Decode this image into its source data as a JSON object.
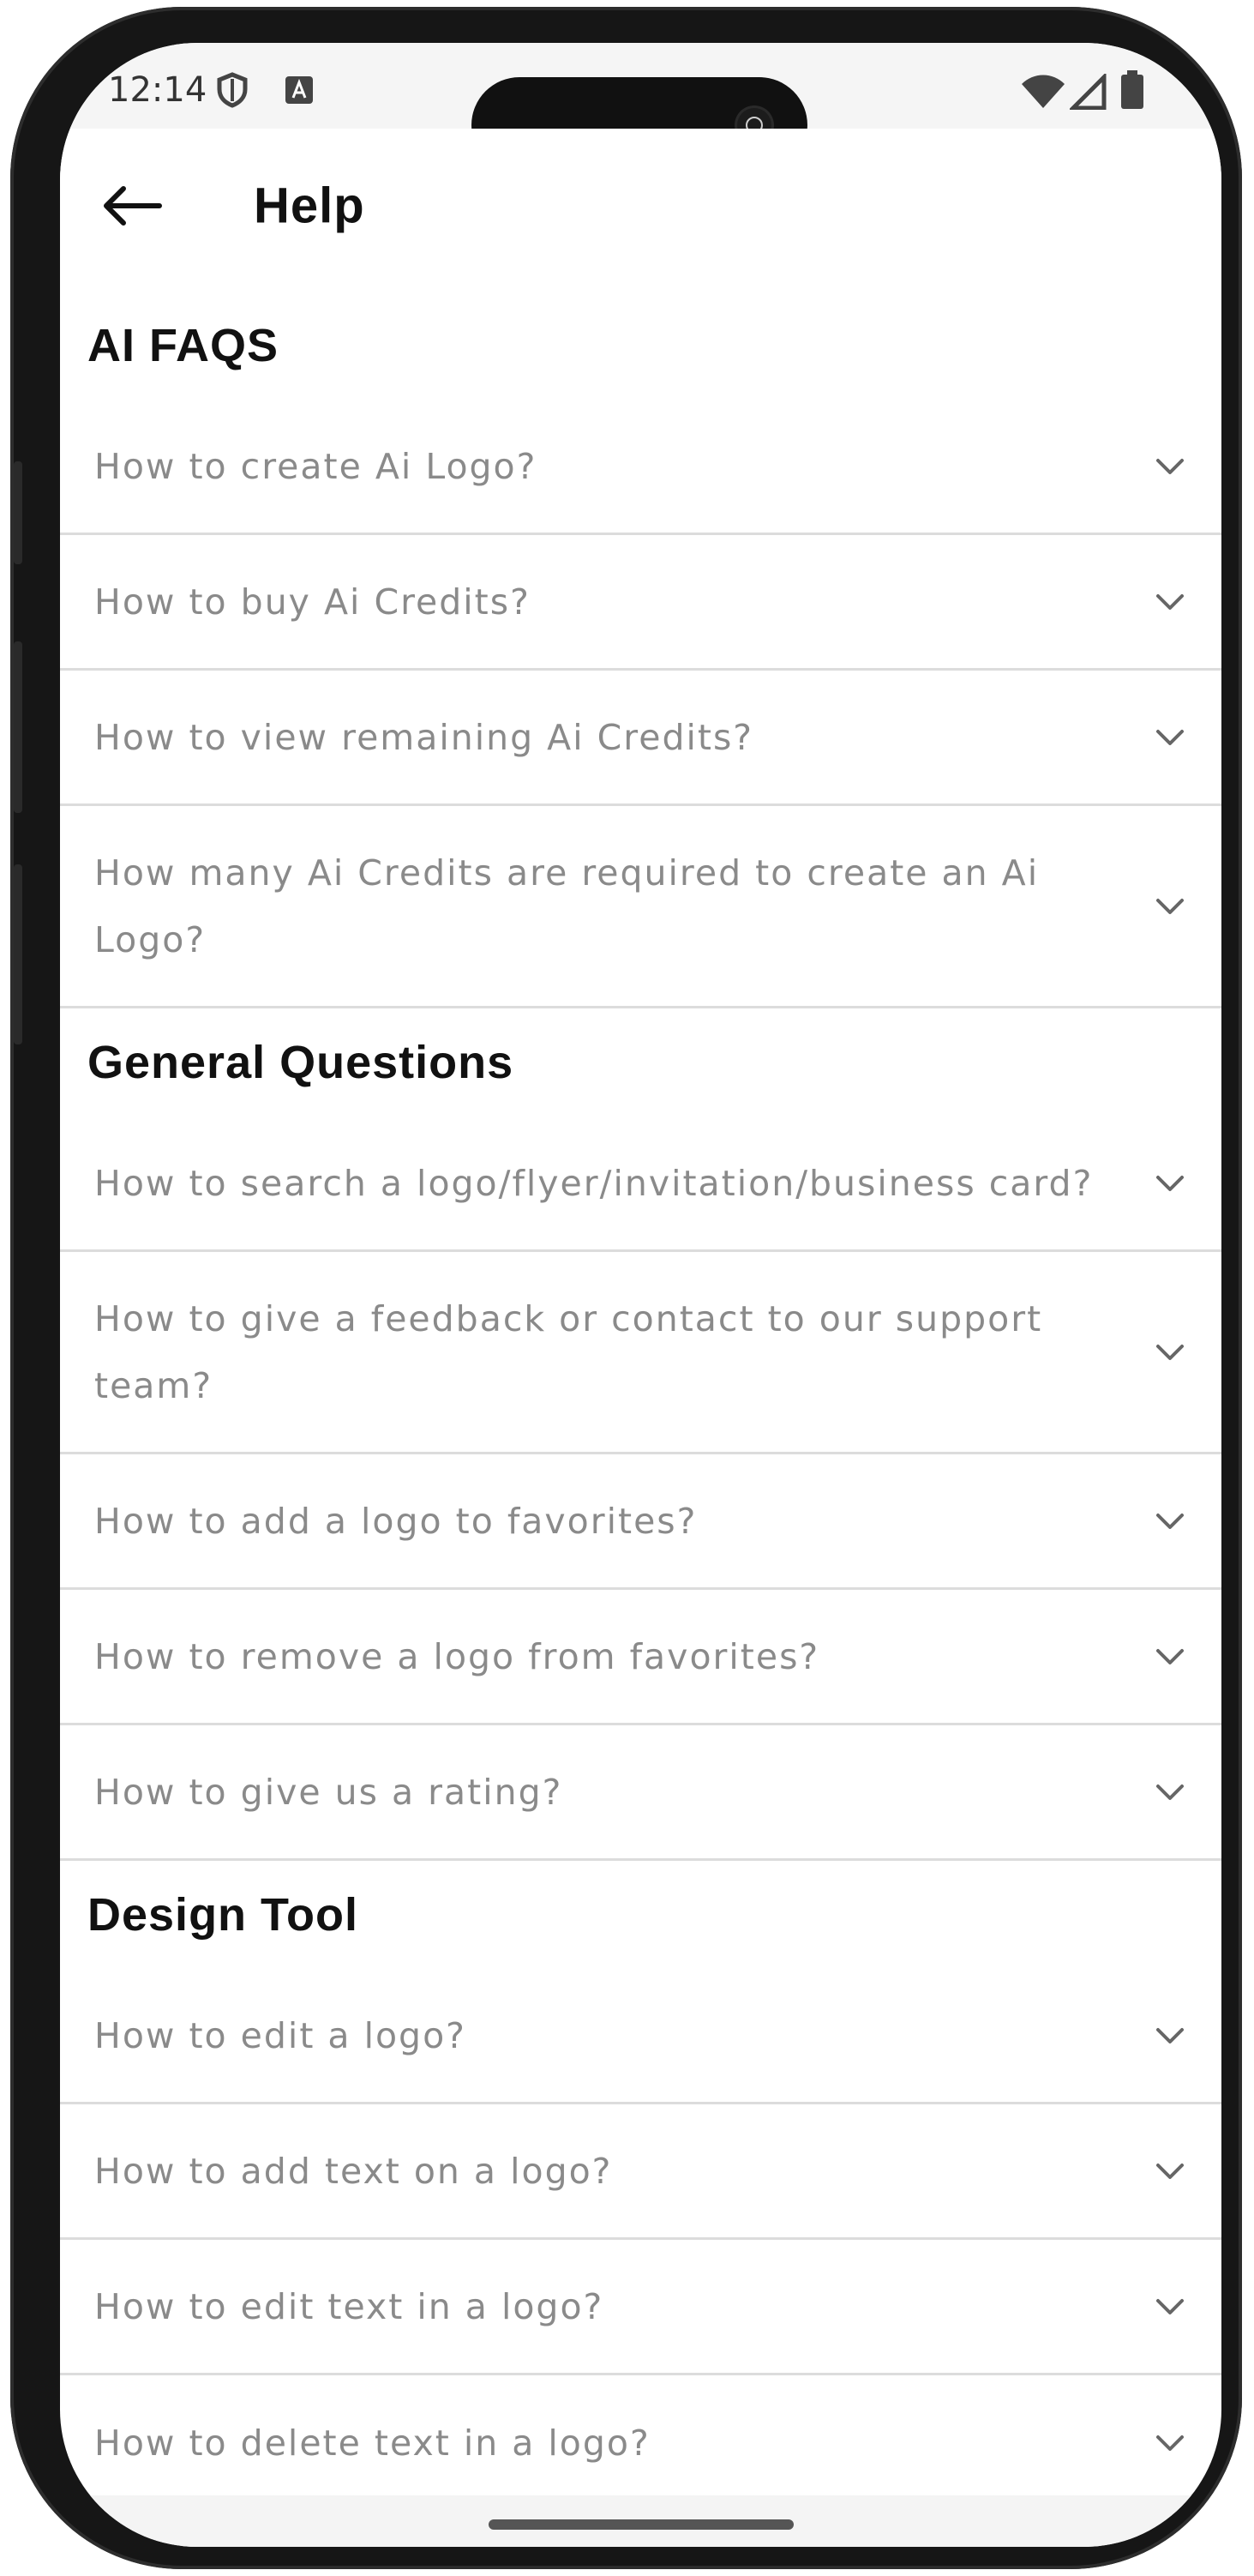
{
  "status_bar": {
    "time": "12:14",
    "icons_left": [
      "shield-icon",
      "app-a-icon"
    ],
    "icons_right": [
      "wifi-icon",
      "cell-signal-icon",
      "battery-icon"
    ]
  },
  "app_bar": {
    "back_icon": "arrow-left-icon",
    "title": "Help"
  },
  "sections": [
    {
      "title": "AI FAQS",
      "items": [
        "How to create Ai Logo?",
        "How to buy Ai Credits?",
        "How to view remaining Ai Credits?",
        "How many Ai Credits are required to create an Ai Logo?"
      ]
    },
    {
      "title": "General Questions",
      "items": [
        "How to search a logo/flyer/invitation/business card?",
        "How to give a feedback or contact to our support team?",
        "How to add a logo to favorites?",
        "How to remove a logo from favorites?",
        "How to give us a rating?"
      ]
    },
    {
      "title": "Design Tool",
      "items": [
        "How to edit a logo?",
        "How to add text on a logo?",
        "How to edit text in a logo?",
        "How to delete text in a logo?"
      ]
    }
  ],
  "colors": {
    "question_text": "#8a8a8a",
    "divider": "#dcdcdc",
    "title_text": "#111111"
  }
}
